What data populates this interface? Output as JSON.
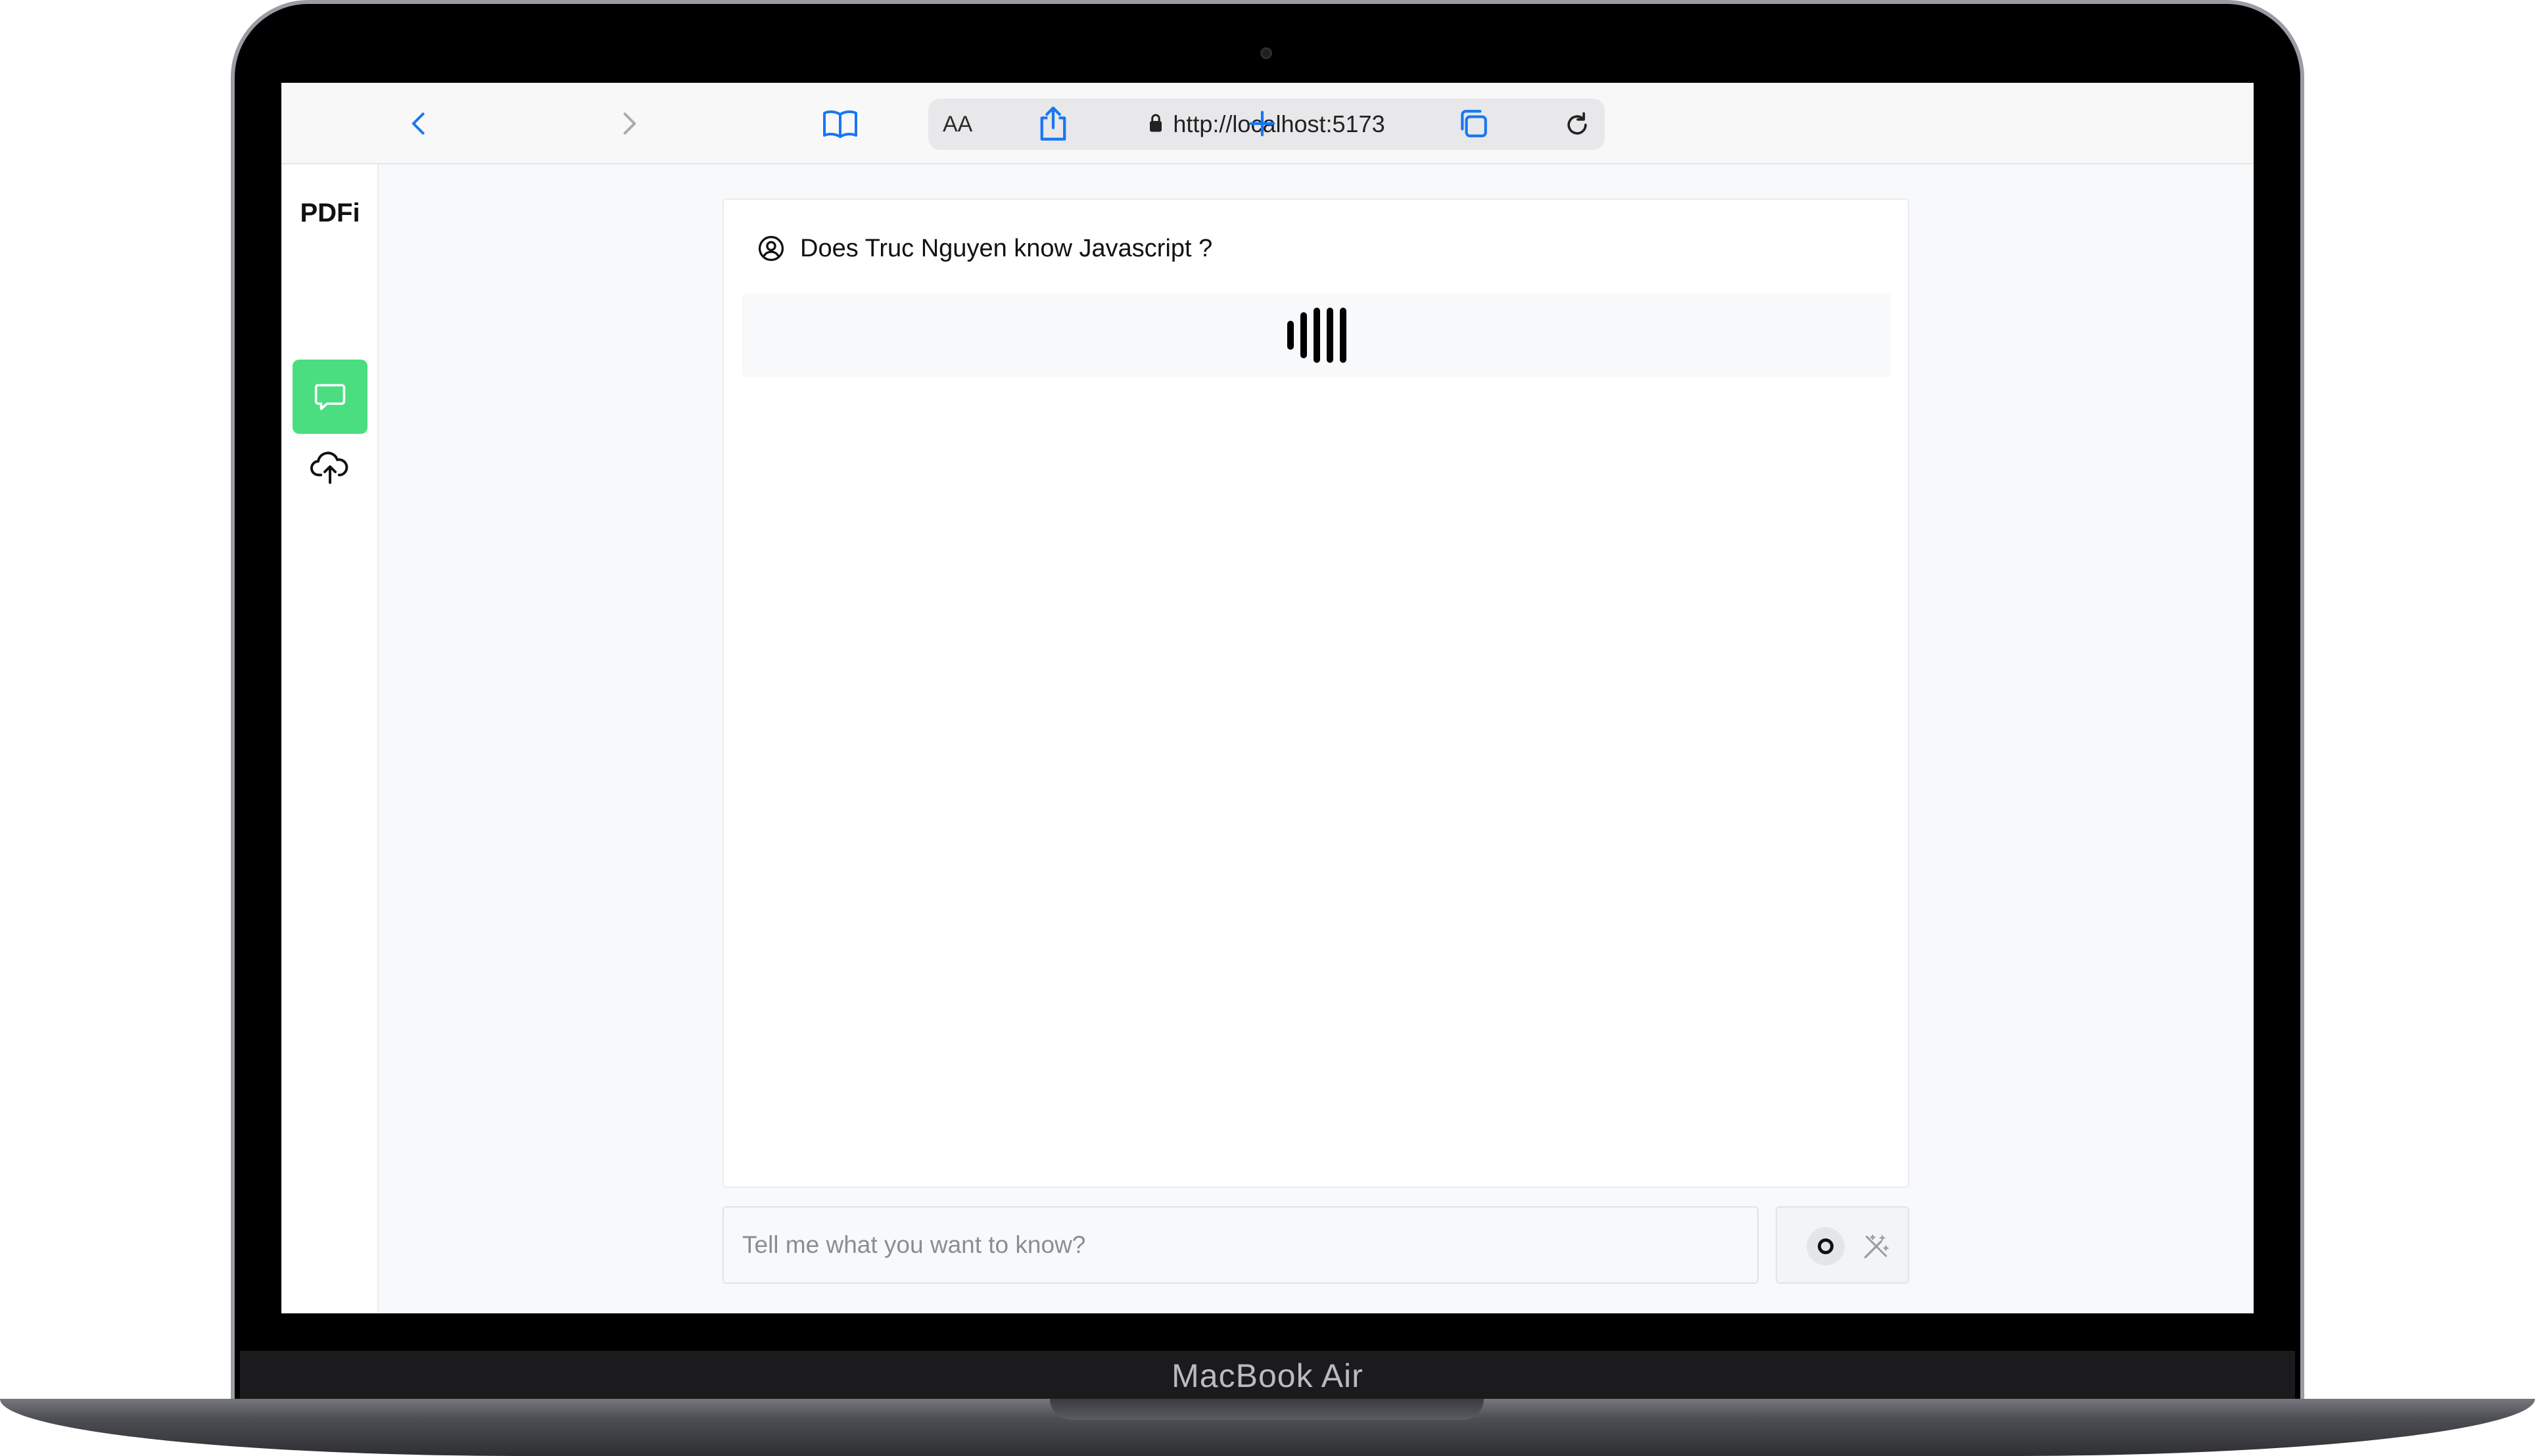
{
  "device": {
    "label": "MacBook Air"
  },
  "browser": {
    "text_size_label": "AA",
    "url": "http://localhost:5173",
    "icons": {
      "back": "chevron-left-icon",
      "forward": "chevron-right-icon",
      "bookmarks": "book-icon",
      "lock": "lock-icon",
      "reload": "reload-icon",
      "share": "share-icon",
      "new_tab": "plus-icon",
      "tabs": "tabs-icon"
    },
    "accent_color": "#1877f2"
  },
  "sidebar": {
    "brand": "PDFi",
    "items": [
      {
        "id": "chat",
        "icon": "chat-bubble-icon",
        "active": true
      },
      {
        "id": "upload",
        "icon": "cloud-upload-icon",
        "active": false
      }
    ],
    "active_color": "#4ade80"
  },
  "chat": {
    "question": "Does Truc Nguyen know Javascript ?",
    "question_icon": "user-circle-icon",
    "answer_state": "loading",
    "loading_icon": "audio-bars-loader-icon"
  },
  "composer": {
    "placeholder": "Tell me what you want to know?",
    "value": "",
    "record_icon": "record-icon",
    "magic_icon": "magic-wand-icon"
  }
}
